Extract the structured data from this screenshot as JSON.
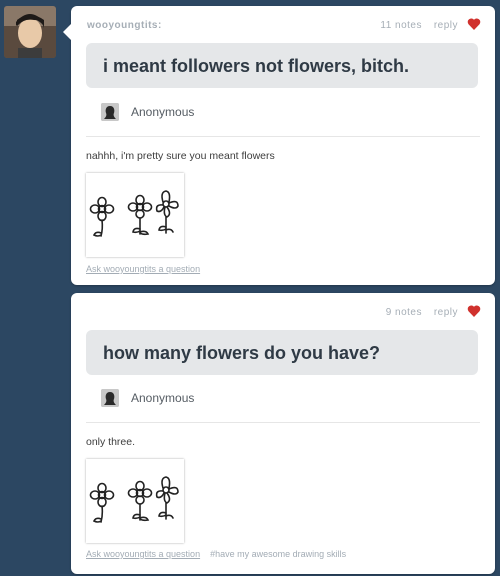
{
  "posts": [
    {
      "username": "wooyoungtits:",
      "notes": "11 notes",
      "reply": "reply",
      "question": "i meant followers not flowers, bitch.",
      "asker": "Anonymous",
      "answer": "nahhh, i'm pretty sure you meant flowers",
      "ask_link": "Ask wooyoungtits a question",
      "tag": ""
    },
    {
      "notes": "9 notes",
      "reply": "reply",
      "question": "how many flowers do you have?",
      "asker": "Anonymous",
      "answer": "only three.",
      "ask_link": "Ask wooyoungtits a question",
      "tag": "#have my awesome drawing skills"
    }
  ],
  "colors": {
    "background": "#2c4762",
    "heart": "#d0312d",
    "question_bg": "#e5e7e9"
  },
  "icons": {
    "like": "heart-icon",
    "avatar": "blog-avatar",
    "asker": "anonymous-avatar"
  }
}
